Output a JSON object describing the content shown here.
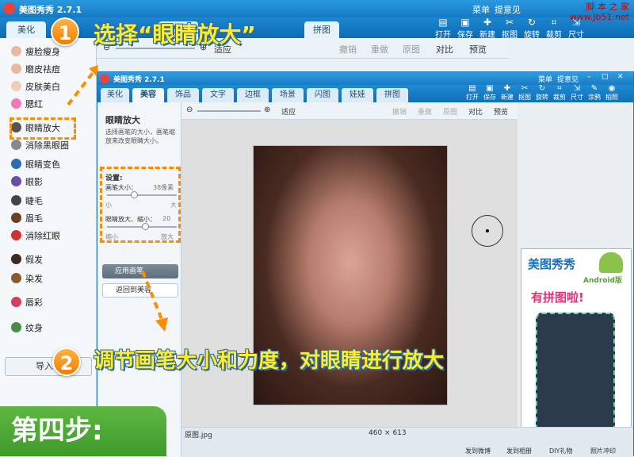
{
  "outer": {
    "app_title": "美图秀秀 2.7.1",
    "menu": "菜单",
    "feedback": "提意见",
    "tab_beautify": "美化",
    "tab_border": "边框",
    "tab_collage": "拼图",
    "toolbar_buttons": [
      "打开",
      "保存",
      "新建",
      "抠图",
      "旋转",
      "裁剪",
      "尺寸"
    ],
    "toolbar": {
      "fit": "适应",
      "undo": "撤销",
      "redo": "重做",
      "original": "原图",
      "compare": "对比",
      "preview": "预览"
    },
    "left_items": [
      "瘦脸瘦身",
      "磨皮祛痘",
      "皮肤美白",
      "腮红",
      "眼睛放大",
      "消除黑眼圈",
      "眼睛变色",
      "眼影",
      "睫毛",
      "眉毛",
      "消除红眼",
      "假发",
      "染发",
      "唇彩",
      "纹身"
    ],
    "import_btn": "导入"
  },
  "inner": {
    "app_title": "美图秀秀 2.7.1",
    "menu": "菜单",
    "feedback": "提意见",
    "tabs": [
      "美化",
      "美容",
      "饰品",
      "文字",
      "边框",
      "场景",
      "闪图",
      "娃娃",
      "拼图"
    ],
    "toolbar_buttons": [
      "打开",
      "保存",
      "新建",
      "抠图",
      "旋转",
      "裁剪",
      "尺寸",
      "涂鸦",
      "拍照"
    ],
    "toolbar": {
      "fit": "适应",
      "undo": "撤销",
      "redo": "重做",
      "original": "原图",
      "compare": "对比",
      "preview": "预览"
    },
    "panel_title": "眼睛放大",
    "panel_desc": "选择画笔的大小，画笔缩放来改变眼睛大小。",
    "settings_label": "设置:",
    "brush_size_label": "画笔大小：",
    "brush_size_value": "38像素",
    "small": "小",
    "large": "大",
    "zoom_label": "眼睛放大、缩小：",
    "zoom_value": "20",
    "shrink": "缩小",
    "enlarge": "放大",
    "apply_btn": "应用画笔",
    "back_btn": "返回到美容",
    "filename": "原图.jpg",
    "dimensions": "460 × 613",
    "status": [
      "发到微博",
      "发到相册",
      "DIY礼物",
      "照片冲印"
    ],
    "ad_line1": "美图秀秀",
    "ad_line2": "Android版",
    "ad_line3": "有拼图啦!"
  },
  "overlay": {
    "step1_num": "1",
    "step1_text": "选择“眼睛放大”",
    "step2_num": "2",
    "step2_text": "调节画笔大小和力度，对眼睛进行放大",
    "step4": "第四步:"
  },
  "watermark": {
    "line1": "脚 本 之 家",
    "line2": "www.Jb51.net"
  },
  "colors": {
    "accent": "#1679c2",
    "step_text": "#ffec2a",
    "dash": "#ff8c00",
    "step4_bg": "#4aa832"
  }
}
